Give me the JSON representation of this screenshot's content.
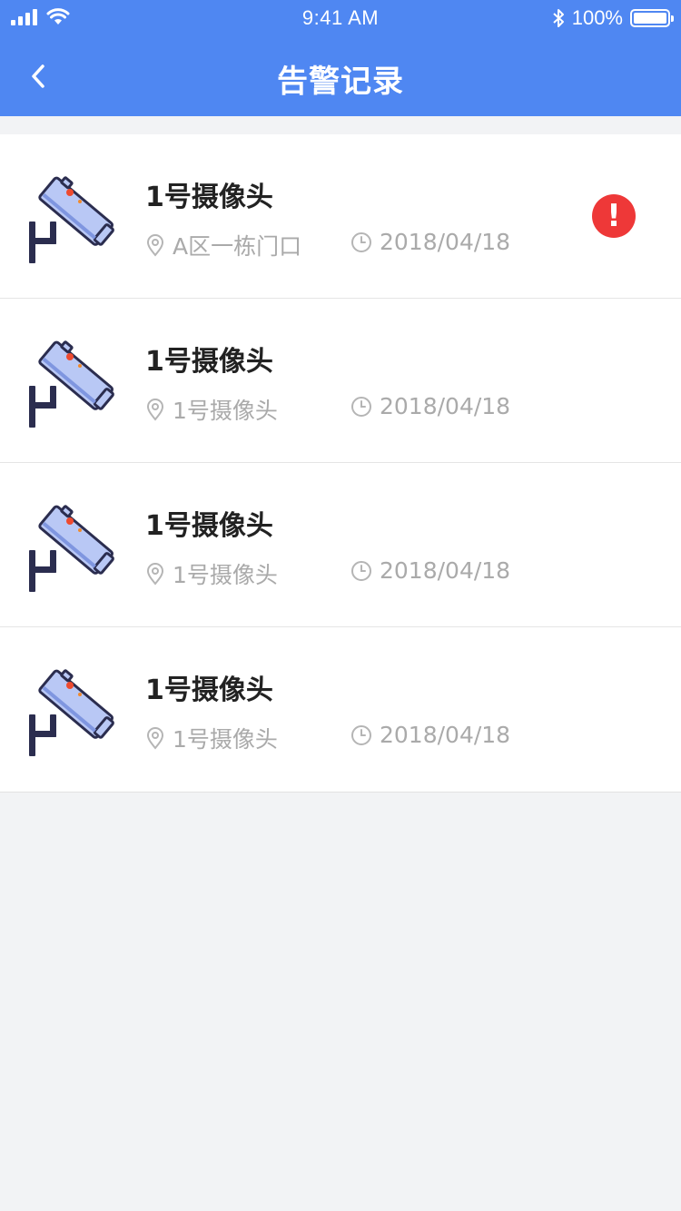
{
  "status_bar": {
    "time": "9:41 AM",
    "battery_text": "100%",
    "battery_level": 1.0
  },
  "nav": {
    "title": "告警记录",
    "back_icon": "chevron-left-icon"
  },
  "colors": {
    "header_bg": "#4f87f2",
    "alert_red": "#ee3838",
    "camera_body": "#b9c8f5",
    "camera_outline": "#2b2d4f"
  },
  "alarms": [
    {
      "title": "1号摄像头",
      "location": "A区一栋门口",
      "date": "2018/04/18",
      "alert": true,
      "alert_text": "!"
    },
    {
      "title": "1号摄像头",
      "location": "1号摄像头",
      "date": "2018/04/18",
      "alert": false
    },
    {
      "title": "1号摄像头",
      "location": "1号摄像头",
      "date": "2018/04/18",
      "alert": false
    },
    {
      "title": "1号摄像头",
      "location": "1号摄像头",
      "date": "2018/04/18",
      "alert": false
    }
  ]
}
